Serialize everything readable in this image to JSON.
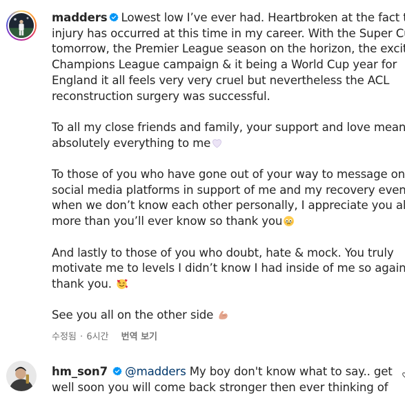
{
  "post": {
    "username": "madders",
    "paragraphs": [
      {
        "lines": [
          "Lowest low I’ve ever had. Heartbroken at the fact this",
          "injury has occurred at this time in my career. With the Super Cup",
          "tomorrow, the Premier League season on the horizon, the exciting",
          "Champions League campaign & it being a World Cup year for",
          "England it all feels very very cruel but nevertheless the ACL",
          "reconstruction surgery was successful."
        ]
      },
      {
        "lines": [
          "To all my close friends and family, your support and love means",
          "absolutely everything to me"
        ],
        "emoji": "white-heart"
      },
      {
        "lines": [
          "To those of you who have gone out of your way to message on",
          "social media platforms in support of me and my recovery even",
          "when we don’t know each other personally, I appreciate you all",
          "more than you’ll ever know so thank you"
        ],
        "emoji": "holding-back-tears"
      },
      {
        "lines": [
          "And lastly to those of you who doubt, hate & mock. You truly",
          "motivate me to levels I didn’t know I had inside of me so again,",
          "thank you. "
        ],
        "emoji": "smiling-face-with-hearts"
      },
      {
        "lines": [
          "See you all on the other side "
        ],
        "emoji": "flexed-biceps"
      }
    ],
    "edited_label": "수정됨",
    "separator": "·",
    "time_ago": "6시간",
    "translate_label": "번역 보기"
  },
  "comment": {
    "username": "hm_son7",
    "mention": "@madders",
    "lines": [
      " My boy don't know what to say.. get",
      "well soon you will come back stronger then ever thinking of"
    ]
  },
  "colors": {
    "verified_blue": "#0095f6",
    "mention_blue": "#00376b",
    "meta_gray": "#737373",
    "text": "#262626"
  }
}
